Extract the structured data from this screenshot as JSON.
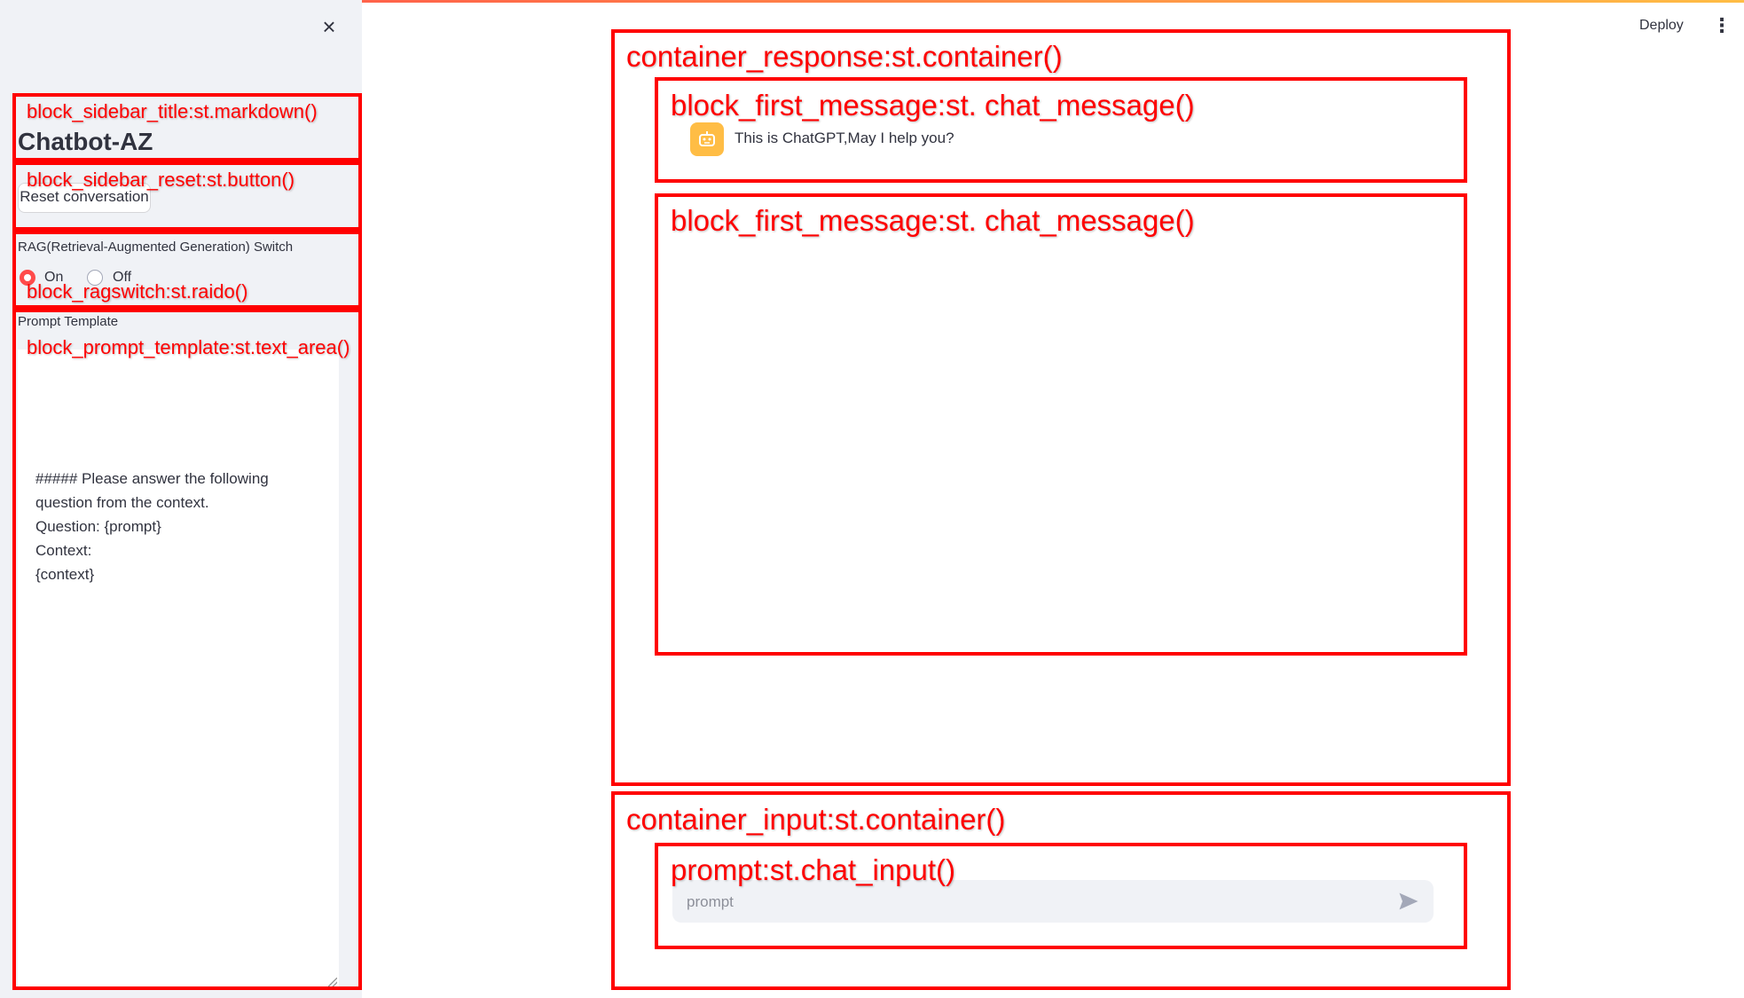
{
  "sidebar": {
    "title": "Chatbot-AZ",
    "reset_label": "Reset conversation",
    "rag_label": "RAG(Retrieval-Augmented Generation) Switch",
    "rag_options": [
      "On",
      "Off"
    ],
    "rag_selected": "On",
    "prompt_label": "Prompt Template",
    "prompt_value": "##### Please answer the following\nquestion from the context.\nQuestion: {prompt}\nContext:\n{context}"
  },
  "header": {
    "deploy_label": "Deploy",
    "close_symbol": "×",
    "menu_symbol": "⋮"
  },
  "chat": {
    "first_message": "This is ChatGPT,May I help you?",
    "input_placeholder": "prompt"
  },
  "annotations": {
    "sidebar_title": "block_sidebar_title:st.markdown()",
    "sidebar_reset": "block_sidebar_reset:st.button()",
    "ragswitch": "block_ragswitch:st.raido()",
    "prompt_template": "block_prompt_template:st.text_area()",
    "container_response": "container_response:st.container()",
    "first_message": "block_first_message:st. chat_message()",
    "second_message": "block_first_message:st. chat_message()",
    "container_input": "container_input:st.container()",
    "prompt": "prompt:st.chat_input()"
  },
  "colors": {
    "annotation": "#ff0000",
    "accent": "#ff4b4b",
    "avatar": "#ffbd45",
    "sidebar_bg": "#f0f2f6"
  },
  "icons": [
    "close-icon",
    "kebab-menu-icon",
    "bot-avatar-icon",
    "send-icon"
  ]
}
